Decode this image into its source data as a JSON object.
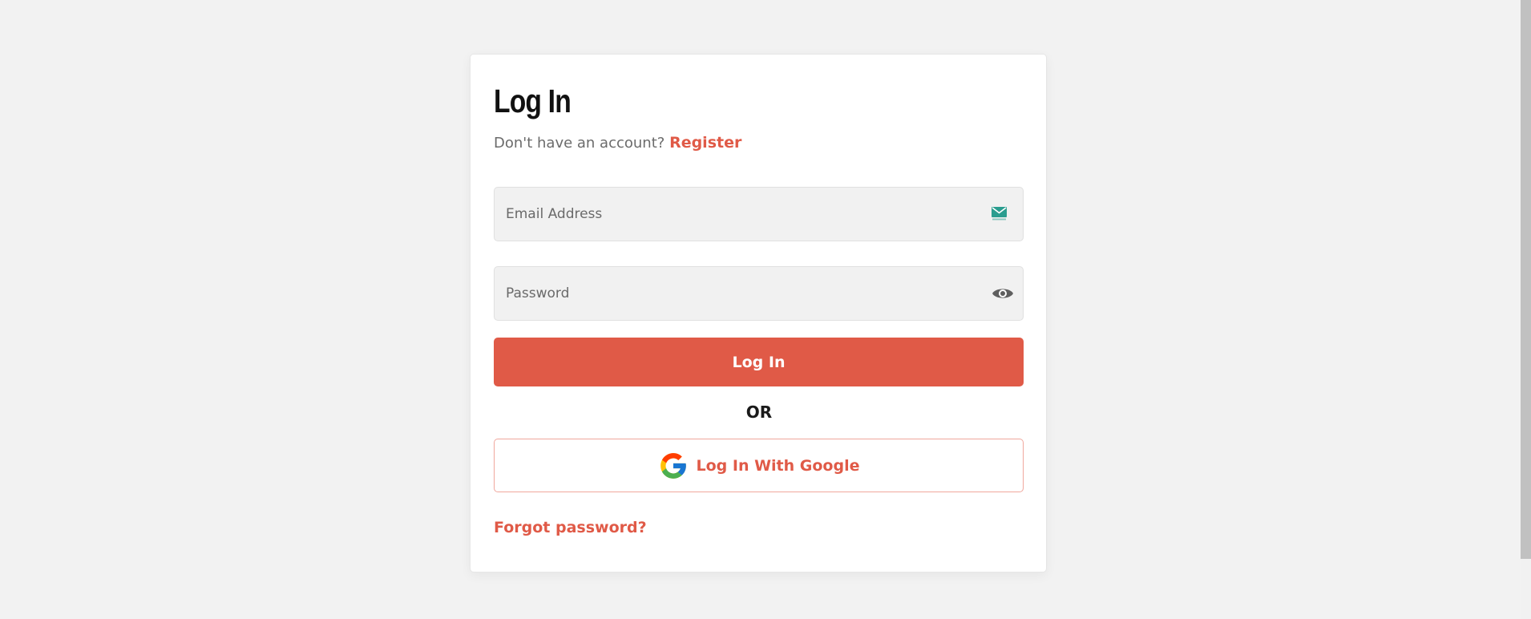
{
  "login": {
    "title": "Log In",
    "subtitle": "Don't have an account?",
    "register_label": "Register",
    "email_placeholder": "Email Address",
    "email_value": "",
    "password_placeholder": "Password",
    "password_value": "",
    "login_button_label": "Log In",
    "or_label": "OR",
    "google_button_label": "Log In With Google",
    "forgot_label": "Forgot password?"
  },
  "icons": {
    "email": "envelope-icon",
    "password_toggle": "eye-icon",
    "google": "google-icon"
  },
  "colors": {
    "accent": "#e05a47",
    "page_background": "#f2f2f2",
    "card_background": "#ffffff",
    "input_background": "#f1f1f1",
    "google_border": "#f0a79d",
    "envelope_icon": "#2a9d8f"
  }
}
